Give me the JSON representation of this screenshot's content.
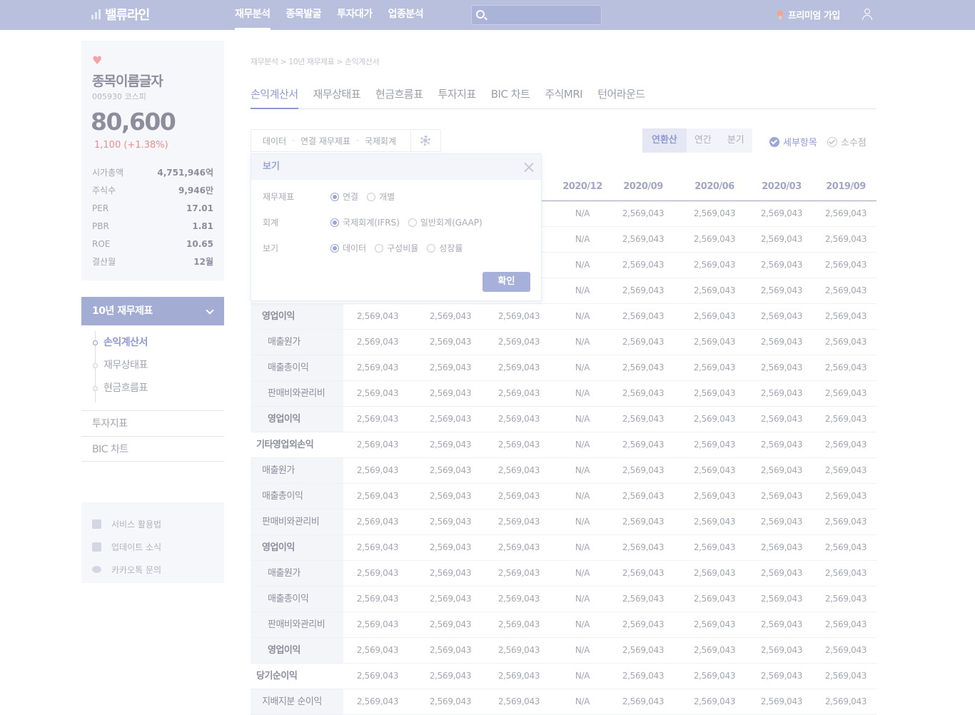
{
  "app": {
    "logo_text": "밸류라인"
  },
  "nav": {
    "items": [
      {
        "label": "재무분석",
        "active": true
      },
      {
        "label": "종목발굴",
        "active": false
      },
      {
        "label": "투자대가",
        "active": false
      },
      {
        "label": "업종분석",
        "active": false
      }
    ],
    "search_placeholder": "",
    "premium_label": "프리미엄 가입"
  },
  "stock": {
    "name": "종목이름글자",
    "code_market": "005930 코스피",
    "price": "80,600",
    "change": "1,100 (+1.38%)",
    "metrics": [
      {
        "label": "시가총액",
        "value": "4,751,946억"
      },
      {
        "label": "주식수",
        "value": "9,946만"
      },
      {
        "label": "PER",
        "value": "17.01"
      },
      {
        "label": "PBR",
        "value": "1.81"
      },
      {
        "label": "ROE",
        "value": "10.65"
      },
      {
        "label": "결산월",
        "value": "12월"
      }
    ]
  },
  "sidebar": {
    "section_title": "10년 재무제표",
    "submenu": [
      {
        "label": "손익계산서",
        "active": true
      },
      {
        "label": "재무상태표",
        "active": false
      },
      {
        "label": "현금흐름표",
        "active": false
      }
    ],
    "links": [
      "투자지표",
      "BIC 차트"
    ],
    "help": [
      "서비스 활용법",
      "업데이트 소식",
      "카카오톡 문의"
    ]
  },
  "breadcrumb": "재무분석 > 10년 재무제표 > 손익계산서",
  "tabs": [
    {
      "label": "손익계산서",
      "active": true
    },
    {
      "label": "재무상태표",
      "active": false
    },
    {
      "label": "현금흐름표",
      "active": false
    },
    {
      "label": "투자지표",
      "active": false
    },
    {
      "label": "BIC 차트",
      "active": false
    },
    {
      "label": "주식MRI",
      "active": false
    },
    {
      "label": "턴어라운드",
      "active": false
    }
  ],
  "filters": [
    "데이터",
    "연결 재무제표",
    "국제회계"
  ],
  "period_options": [
    {
      "label": "연환산",
      "active": true
    },
    {
      "label": "연간",
      "active": false
    },
    {
      "label": "분기",
      "active": false
    }
  ],
  "toggles": [
    {
      "label": "세부항목",
      "checked": true
    },
    {
      "label": "소수점",
      "checked": false
    }
  ],
  "popup": {
    "title": "보기",
    "rows": [
      {
        "label": "재무제표",
        "options": [
          {
            "label": "연결",
            "selected": true
          },
          {
            "label": "개별",
            "selected": false
          }
        ]
      },
      {
        "label": "회계",
        "options": [
          {
            "label": "국제회계(IFRS)",
            "selected": true
          },
          {
            "label": "일반회계(GAAP)",
            "selected": false
          }
        ]
      },
      {
        "label": "보기",
        "options": [
          {
            "label": "데이터",
            "selected": true
          },
          {
            "label": "구성비율",
            "selected": false
          },
          {
            "label": "성장률",
            "selected": false
          }
        ]
      }
    ],
    "confirm_label": "확인"
  },
  "table": {
    "columns": [
      "",
      "",
      "",
      "",
      "2020/12",
      "2020/09",
      "2020/06",
      "2020/03",
      "2019/09"
    ],
    "rows": [
      {
        "label": "",
        "level": 0,
        "values": [
          "",
          "",
          "",
          "N/A",
          "2,569,043",
          "2,569,043",
          "2,569,043",
          "2,569,043"
        ]
      },
      {
        "label": "",
        "level": 0,
        "values": [
          "",
          "",
          "",
          "N/A",
          "2,569,043",
          "2,569,043",
          "2,569,043",
          "2,569,043"
        ]
      },
      {
        "label": "",
        "level": 0,
        "values": [
          "",
          "",
          "",
          "N/A",
          "2,569,043",
          "2,569,043",
          "2,569,043",
          "2,569,043"
        ]
      },
      {
        "label": "",
        "level": 0,
        "values": [
          "",
          "",
          "",
          "N/A",
          "2,569,043",
          "2,569,043",
          "2,569,043",
          "2,569,043"
        ]
      },
      {
        "label": "영업이익",
        "level": 1,
        "bold": true,
        "values": [
          "2,569,043",
          "2,569,043",
          "2,569,043",
          "N/A",
          "2,569,043",
          "2,569,043",
          "2,569,043",
          "2,569,043"
        ]
      },
      {
        "label": "매출원가",
        "level": 2,
        "values": [
          "2,569,043",
          "2,569,043",
          "2,569,043",
          "N/A",
          "2,569,043",
          "2,569,043",
          "2,569,043",
          "2,569,043"
        ]
      },
      {
        "label": "매출총이익",
        "level": 2,
        "values": [
          "2,569,043",
          "2,569,043",
          "2,569,043",
          "N/A",
          "2,569,043",
          "2,569,043",
          "2,569,043",
          "2,569,043"
        ]
      },
      {
        "label": "판매비와관리비",
        "level": 2,
        "values": [
          "2,569,043",
          "2,569,043",
          "2,569,043",
          "N/A",
          "2,569,043",
          "2,569,043",
          "2,569,043",
          "2,569,043"
        ]
      },
      {
        "label": "영업이익",
        "level": 2,
        "bold": true,
        "values": [
          "2,569,043",
          "2,569,043",
          "2,569,043",
          "N/A",
          "2,569,043",
          "2,569,043",
          "2,569,043",
          "2,569,043"
        ]
      },
      {
        "label": "기타영업외손익",
        "level": 0,
        "values": [
          "2,569,043",
          "2,569,043",
          "2,569,043",
          "N/A",
          "2,569,043",
          "2,569,043",
          "2,569,043",
          "2,569,043"
        ]
      },
      {
        "label": "매출원가",
        "level": 1,
        "values": [
          "2,569,043",
          "2,569,043",
          "2,569,043",
          "N/A",
          "2,569,043",
          "2,569,043",
          "2,569,043",
          "2,569,043"
        ]
      },
      {
        "label": "매출총이익",
        "level": 1,
        "values": [
          "2,569,043",
          "2,569,043",
          "2,569,043",
          "N/A",
          "2,569,043",
          "2,569,043",
          "2,569,043",
          "2,569,043"
        ]
      },
      {
        "label": "판매비와관리비",
        "level": 1,
        "values": [
          "2,569,043",
          "2,569,043",
          "2,569,043",
          "N/A",
          "2,569,043",
          "2,569,043",
          "2,569,043",
          "2,569,043"
        ]
      },
      {
        "label": "영업이익",
        "level": 1,
        "bold": true,
        "values": [
          "2,569,043",
          "2,569,043",
          "2,569,043",
          "N/A",
          "2,569,043",
          "2,569,043",
          "2,569,043",
          "2,569,043"
        ]
      },
      {
        "label": "매출원가",
        "level": 2,
        "values": [
          "2,569,043",
          "2,569,043",
          "2,569,043",
          "N/A",
          "2,569,043",
          "2,569,043",
          "2,569,043",
          "2,569,043"
        ]
      },
      {
        "label": "매출총이익",
        "level": 2,
        "values": [
          "2,569,043",
          "2,569,043",
          "2,569,043",
          "N/A",
          "2,569,043",
          "2,569,043",
          "2,569,043",
          "2,569,043"
        ]
      },
      {
        "label": "판매비와관리비",
        "level": 2,
        "values": [
          "2,569,043",
          "2,569,043",
          "2,569,043",
          "N/A",
          "2,569,043",
          "2,569,043",
          "2,569,043",
          "2,569,043"
        ]
      },
      {
        "label": "영업이익",
        "level": 2,
        "bold": true,
        "values": [
          "2,569,043",
          "2,569,043",
          "2,569,043",
          "N/A",
          "2,569,043",
          "2,569,043",
          "2,569,043",
          "2,569,043"
        ]
      },
      {
        "label": "당기순이익",
        "level": 0,
        "values": [
          "2,569,043",
          "2,569,043",
          "2,569,043",
          "N/A",
          "2,569,043",
          "2,569,043",
          "2,569,043",
          "2,569,043"
        ]
      },
      {
        "label": "지배지분 순이익",
        "level": 1,
        "values": [
          "2,569,043",
          "2,569,043",
          "2,569,043",
          "N/A",
          "2,569,043",
          "2,569,043",
          "2,569,043",
          "2,569,043"
        ]
      }
    ]
  }
}
